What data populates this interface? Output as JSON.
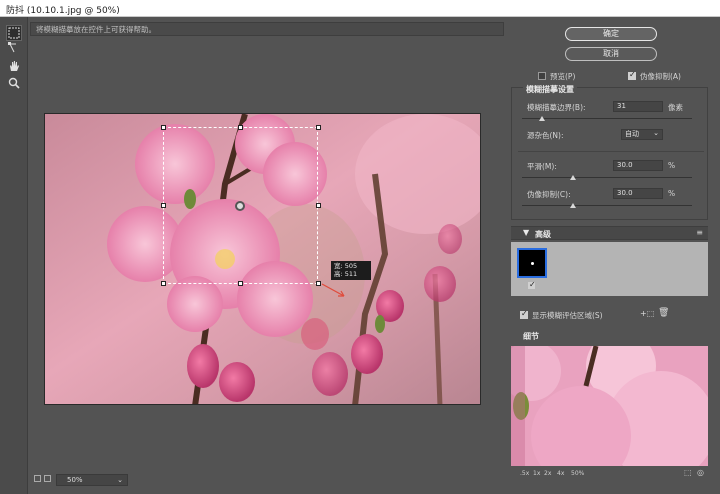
{
  "window": {
    "title": "防抖 (10.10.1.jpg @ 50%)"
  },
  "hint": {
    "text": "将模糊描摹放在控件上可获得帮助。"
  },
  "tools": [
    {
      "name": "blur-trace-tool-icon"
    },
    {
      "name": "blur-direction-tool-icon"
    },
    {
      "name": "hand-tool-icon"
    },
    {
      "name": "zoom-tool-icon"
    }
  ],
  "readout": {
    "line1": "宽: 505",
    "line2": "高: 511"
  },
  "footer": {
    "zoom": "50%"
  },
  "buttons": {
    "ok": "确定",
    "cancel": "取消"
  },
  "options": {
    "preview_label": "预览(P)",
    "preview_checked": false,
    "artifact_label": "伪像抑制(A)",
    "artifact_checked": true
  },
  "trace": {
    "title": "模糊描摹设置",
    "bounds_label": "模糊描摹边界(B):",
    "bounds_value": "31",
    "bounds_unit": "像素",
    "bounds_level": 0.12,
    "noise_label": "源杂色(N):",
    "noise_value": "自动",
    "smooth_label": "平滑(M):",
    "smooth_value": "30.0",
    "smooth_unit": "%",
    "smooth_level": 0.3,
    "artifact_label": "伪像抑制(C):",
    "artifact_value": "30.0",
    "artifact_unit": "%",
    "artifact_level": 0.3
  },
  "advanced": {
    "title": "高级",
    "show_label": "显示模糊评估区域(S)",
    "show_checked": true
  },
  "detail": {
    "title": "细节",
    "zooms": [
      ".5x",
      "1x",
      "2x",
      "4x",
      "50%"
    ]
  }
}
